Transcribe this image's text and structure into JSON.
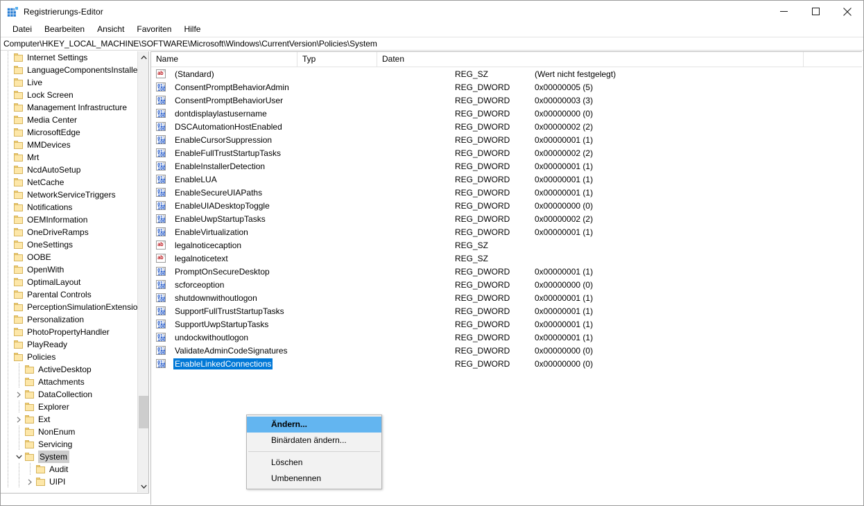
{
  "window": {
    "title": "Registrierungs-Editor",
    "app_icon": "registry-editor-icon",
    "minimize_label": "Minimieren",
    "maximize_label": "Maximieren",
    "close_label": "Schließen"
  },
  "menubar": {
    "items": [
      {
        "label": "Datei"
      },
      {
        "label": "Bearbeiten"
      },
      {
        "label": "Ansicht"
      },
      {
        "label": "Favoriten"
      },
      {
        "label": "Hilfe"
      }
    ]
  },
  "address": {
    "path": "Computer\\HKEY_LOCAL_MACHINE\\SOFTWARE\\Microsoft\\Windows\\CurrentVersion\\Policies\\System"
  },
  "tree": {
    "items": [
      {
        "label": "Internet Settings",
        "depth": 1,
        "expander": "none",
        "selected": false
      },
      {
        "label": "LanguageComponentsInstaller",
        "depth": 1,
        "expander": "none",
        "selected": false
      },
      {
        "label": "Live",
        "depth": 1,
        "expander": "none",
        "selected": false
      },
      {
        "label": "Lock Screen",
        "depth": 1,
        "expander": "none",
        "selected": false
      },
      {
        "label": "Management Infrastructure",
        "depth": 1,
        "expander": "none",
        "selected": false
      },
      {
        "label": "Media Center",
        "depth": 1,
        "expander": "none",
        "selected": false
      },
      {
        "label": "MicrosoftEdge",
        "depth": 1,
        "expander": "none",
        "selected": false
      },
      {
        "label": "MMDevices",
        "depth": 1,
        "expander": "none",
        "selected": false
      },
      {
        "label": "Mrt",
        "depth": 1,
        "expander": "none",
        "selected": false
      },
      {
        "label": "NcdAutoSetup",
        "depth": 1,
        "expander": "none",
        "selected": false
      },
      {
        "label": "NetCache",
        "depth": 1,
        "expander": "none",
        "selected": false
      },
      {
        "label": "NetworkServiceTriggers",
        "depth": 1,
        "expander": "none",
        "selected": false
      },
      {
        "label": "Notifications",
        "depth": 1,
        "expander": "none",
        "selected": false
      },
      {
        "label": "OEMInformation",
        "depth": 1,
        "expander": "none",
        "selected": false
      },
      {
        "label": "OneDriveRamps",
        "depth": 1,
        "expander": "none",
        "selected": false
      },
      {
        "label": "OneSettings",
        "depth": 1,
        "expander": "none",
        "selected": false
      },
      {
        "label": "OOBE",
        "depth": 1,
        "expander": "none",
        "selected": false
      },
      {
        "label": "OpenWith",
        "depth": 1,
        "expander": "none",
        "selected": false
      },
      {
        "label": "OptimalLayout",
        "depth": 1,
        "expander": "none",
        "selected": false
      },
      {
        "label": "Parental Controls",
        "depth": 1,
        "expander": "none",
        "selected": false
      },
      {
        "label": "PerceptionSimulationExtensions",
        "depth": 1,
        "expander": "none",
        "selected": false
      },
      {
        "label": "Personalization",
        "depth": 1,
        "expander": "none",
        "selected": false
      },
      {
        "label": "PhotoPropertyHandler",
        "depth": 1,
        "expander": "none",
        "selected": false
      },
      {
        "label": "PlayReady",
        "depth": 1,
        "expander": "none",
        "selected": false
      },
      {
        "label": "Policies",
        "depth": 1,
        "expander": "none",
        "selected": false
      },
      {
        "label": "ActiveDesktop",
        "depth": 2,
        "expander": "none",
        "selected": false
      },
      {
        "label": "Attachments",
        "depth": 2,
        "expander": "none",
        "selected": false
      },
      {
        "label": "DataCollection",
        "depth": 2,
        "expander": "collapsed",
        "selected": false
      },
      {
        "label": "Explorer",
        "depth": 2,
        "expander": "none",
        "selected": false
      },
      {
        "label": "Ext",
        "depth": 2,
        "expander": "collapsed",
        "selected": false
      },
      {
        "label": "NonEnum",
        "depth": 2,
        "expander": "none",
        "selected": false
      },
      {
        "label": "Servicing",
        "depth": 2,
        "expander": "none",
        "selected": false
      },
      {
        "label": "System",
        "depth": 2,
        "expander": "expanded",
        "selected": true
      },
      {
        "label": "Audit",
        "depth": 3,
        "expander": "none",
        "selected": false
      },
      {
        "label": "UIPI",
        "depth": 3,
        "expander": "collapsed",
        "selected": false
      }
    ]
  },
  "list": {
    "columns": [
      {
        "key": "name",
        "label": "Name"
      },
      {
        "key": "type",
        "label": "Typ"
      },
      {
        "key": "data",
        "label": "Daten"
      }
    ],
    "rows": [
      {
        "icon": "string-value-icon",
        "kind": "sz",
        "name": "(Standard)",
        "type": "REG_SZ",
        "data": "(Wert nicht festgelegt)",
        "selected": false
      },
      {
        "icon": "dword-value-icon",
        "kind": "dw",
        "name": "ConsentPromptBehaviorAdmin",
        "type": "REG_DWORD",
        "data": "0x00000005 (5)",
        "selected": false
      },
      {
        "icon": "dword-value-icon",
        "kind": "dw",
        "name": "ConsentPromptBehaviorUser",
        "type": "REG_DWORD",
        "data": "0x00000003 (3)",
        "selected": false
      },
      {
        "icon": "dword-value-icon",
        "kind": "dw",
        "name": "dontdisplaylastusername",
        "type": "REG_DWORD",
        "data": "0x00000000 (0)",
        "selected": false
      },
      {
        "icon": "dword-value-icon",
        "kind": "dw",
        "name": "DSCAutomationHostEnabled",
        "type": "REG_DWORD",
        "data": "0x00000002 (2)",
        "selected": false
      },
      {
        "icon": "dword-value-icon",
        "kind": "dw",
        "name": "EnableCursorSuppression",
        "type": "REG_DWORD",
        "data": "0x00000001 (1)",
        "selected": false
      },
      {
        "icon": "dword-value-icon",
        "kind": "dw",
        "name": "EnableFullTrustStartupTasks",
        "type": "REG_DWORD",
        "data": "0x00000002 (2)",
        "selected": false
      },
      {
        "icon": "dword-value-icon",
        "kind": "dw",
        "name": "EnableInstallerDetection",
        "type": "REG_DWORD",
        "data": "0x00000001 (1)",
        "selected": false
      },
      {
        "icon": "dword-value-icon",
        "kind": "dw",
        "name": "EnableLUA",
        "type": "REG_DWORD",
        "data": "0x00000001 (1)",
        "selected": false
      },
      {
        "icon": "dword-value-icon",
        "kind": "dw",
        "name": "EnableSecureUIAPaths",
        "type": "REG_DWORD",
        "data": "0x00000001 (1)",
        "selected": false
      },
      {
        "icon": "dword-value-icon",
        "kind": "dw",
        "name": "EnableUIADesktopToggle",
        "type": "REG_DWORD",
        "data": "0x00000000 (0)",
        "selected": false
      },
      {
        "icon": "dword-value-icon",
        "kind": "dw",
        "name": "EnableUwpStartupTasks",
        "type": "REG_DWORD",
        "data": "0x00000002 (2)",
        "selected": false
      },
      {
        "icon": "dword-value-icon",
        "kind": "dw",
        "name": "EnableVirtualization",
        "type": "REG_DWORD",
        "data": "0x00000001 (1)",
        "selected": false
      },
      {
        "icon": "string-value-icon",
        "kind": "sz",
        "name": "legalnoticecaption",
        "type": "REG_SZ",
        "data": "",
        "selected": false
      },
      {
        "icon": "string-value-icon",
        "kind": "sz",
        "name": "legalnoticetext",
        "type": "REG_SZ",
        "data": "",
        "selected": false
      },
      {
        "icon": "dword-value-icon",
        "kind": "dw",
        "name": "PromptOnSecureDesktop",
        "type": "REG_DWORD",
        "data": "0x00000001 (1)",
        "selected": false
      },
      {
        "icon": "dword-value-icon",
        "kind": "dw",
        "name": "scforceoption",
        "type": "REG_DWORD",
        "data": "0x00000000 (0)",
        "selected": false
      },
      {
        "icon": "dword-value-icon",
        "kind": "dw",
        "name": "shutdownwithoutlogon",
        "type": "REG_DWORD",
        "data": "0x00000001 (1)",
        "selected": false
      },
      {
        "icon": "dword-value-icon",
        "kind": "dw",
        "name": "SupportFullTrustStartupTasks",
        "type": "REG_DWORD",
        "data": "0x00000001 (1)",
        "selected": false
      },
      {
        "icon": "dword-value-icon",
        "kind": "dw",
        "name": "SupportUwpStartupTasks",
        "type": "REG_DWORD",
        "data": "0x00000001 (1)",
        "selected": false
      },
      {
        "icon": "dword-value-icon",
        "kind": "dw",
        "name": "undockwithoutlogon",
        "type": "REG_DWORD",
        "data": "0x00000001 (1)",
        "selected": false
      },
      {
        "icon": "dword-value-icon",
        "kind": "dw",
        "name": "ValidateAdminCodeSignatures",
        "type": "REG_DWORD",
        "data": "0x00000000 (0)",
        "selected": false
      },
      {
        "icon": "dword-value-icon",
        "kind": "dw",
        "name": "EnableLinkedConnections",
        "type": "REG_DWORD",
        "data": "0x00000000 (0)",
        "selected": true
      }
    ]
  },
  "context_menu": {
    "items": [
      {
        "label": "Ändern...",
        "active": true,
        "separator_after": false
      },
      {
        "label": "Binärdaten ändern...",
        "active": false,
        "separator_after": true
      },
      {
        "label": "Löschen",
        "active": false,
        "separator_after": false
      },
      {
        "label": "Umbenennen",
        "active": false,
        "separator_after": false
      }
    ]
  },
  "colors": {
    "selection_blue": "#0078d7",
    "menu_highlight": "#63b5f0",
    "tree_selection": "#cdcdcd",
    "folder_yellow": "#fde7a9",
    "dword_icon": "#2a5fcc",
    "string_icon": "#c1272d"
  }
}
